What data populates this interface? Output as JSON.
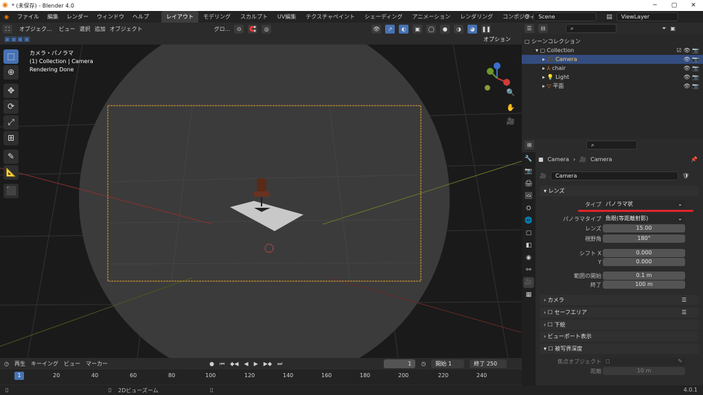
{
  "window": {
    "title": "* (未保存) - Blender 4.0"
  },
  "menu": [
    "ファイル",
    "編集",
    "レンダー",
    "ウィンドウ",
    "ヘルプ"
  ],
  "workspaces": [
    "レイアウト",
    "モデリング",
    "スカルプト",
    "UV編集",
    "テクスチャペイント",
    "シェーディング",
    "アニメーション",
    "レンダリング",
    "コンポジティング"
  ],
  "topright": {
    "scene": "Scene",
    "view_layer": "ViewLayer"
  },
  "viewport_header": {
    "mode": "オブジェク...",
    "view": "ビュー",
    "select": "選択",
    "add": "追加",
    "object": "オブジェクト",
    "transform": "グロ...",
    "options": "オプション"
  },
  "overlay": {
    "line1": "カメラ・パノラマ",
    "line2": "(1) Collection | Camera",
    "line3": "Rendering Done"
  },
  "timeline": {
    "playback": "再生",
    "keying": "キーイング",
    "view": "ビュー",
    "marker": "マーカー",
    "current_frame": "1",
    "start_label": "開始",
    "start": "1",
    "end_label": "終了",
    "end": "250",
    "ticks": [
      "20",
      "40",
      "60",
      "80",
      "100",
      "120",
      "140",
      "160",
      "180",
      "200",
      "220",
      "240"
    ],
    "current_marker": "1"
  },
  "outliner": {
    "scene_collection": "シーンコレクション",
    "collection": "Collection",
    "items": [
      {
        "name": "Camera",
        "selected": true
      },
      {
        "name": "chair",
        "selected": false
      },
      {
        "name": "Light",
        "selected": false
      },
      {
        "name": "平面",
        "selected": false
      }
    ]
  },
  "properties": {
    "breadcrumb_a": "Camera",
    "breadcrumb_b": "Camera",
    "data_name": "Camera",
    "lens_panel": "レンズ",
    "type_label": "タイプ",
    "type_value": "パノラマ状",
    "pano_type_label": "パノラマタイプ",
    "pano_type_value": "魚眼(等距離射影)",
    "lens_label": "レンズ",
    "lens_value": "15.00",
    "fov_label": "視野角",
    "fov_value": "180°",
    "shift_x_label": "シフト X",
    "shift_x_value": "0.000",
    "y_label": "Y",
    "y_value": "0.000",
    "clip_start_label": "範囲の開始",
    "clip_start_value": "0.1 m",
    "clip_end_label": "終了",
    "clip_end_value": "100 m",
    "panels": [
      "カメラ",
      "セーフエリア",
      "下絵",
      "ビューポート表示",
      "被写界深度"
    ],
    "focus_object_label": "焦点オブジェクト",
    "distance_label": "距離",
    "distance_value": "10 m"
  },
  "status": {
    "hint": "2Dビューズーム",
    "version": "4.0.1"
  },
  "colors": {
    "accent": "#4772b3",
    "highlight_line": "#e0242a",
    "camera_frame": "#e0a030"
  }
}
